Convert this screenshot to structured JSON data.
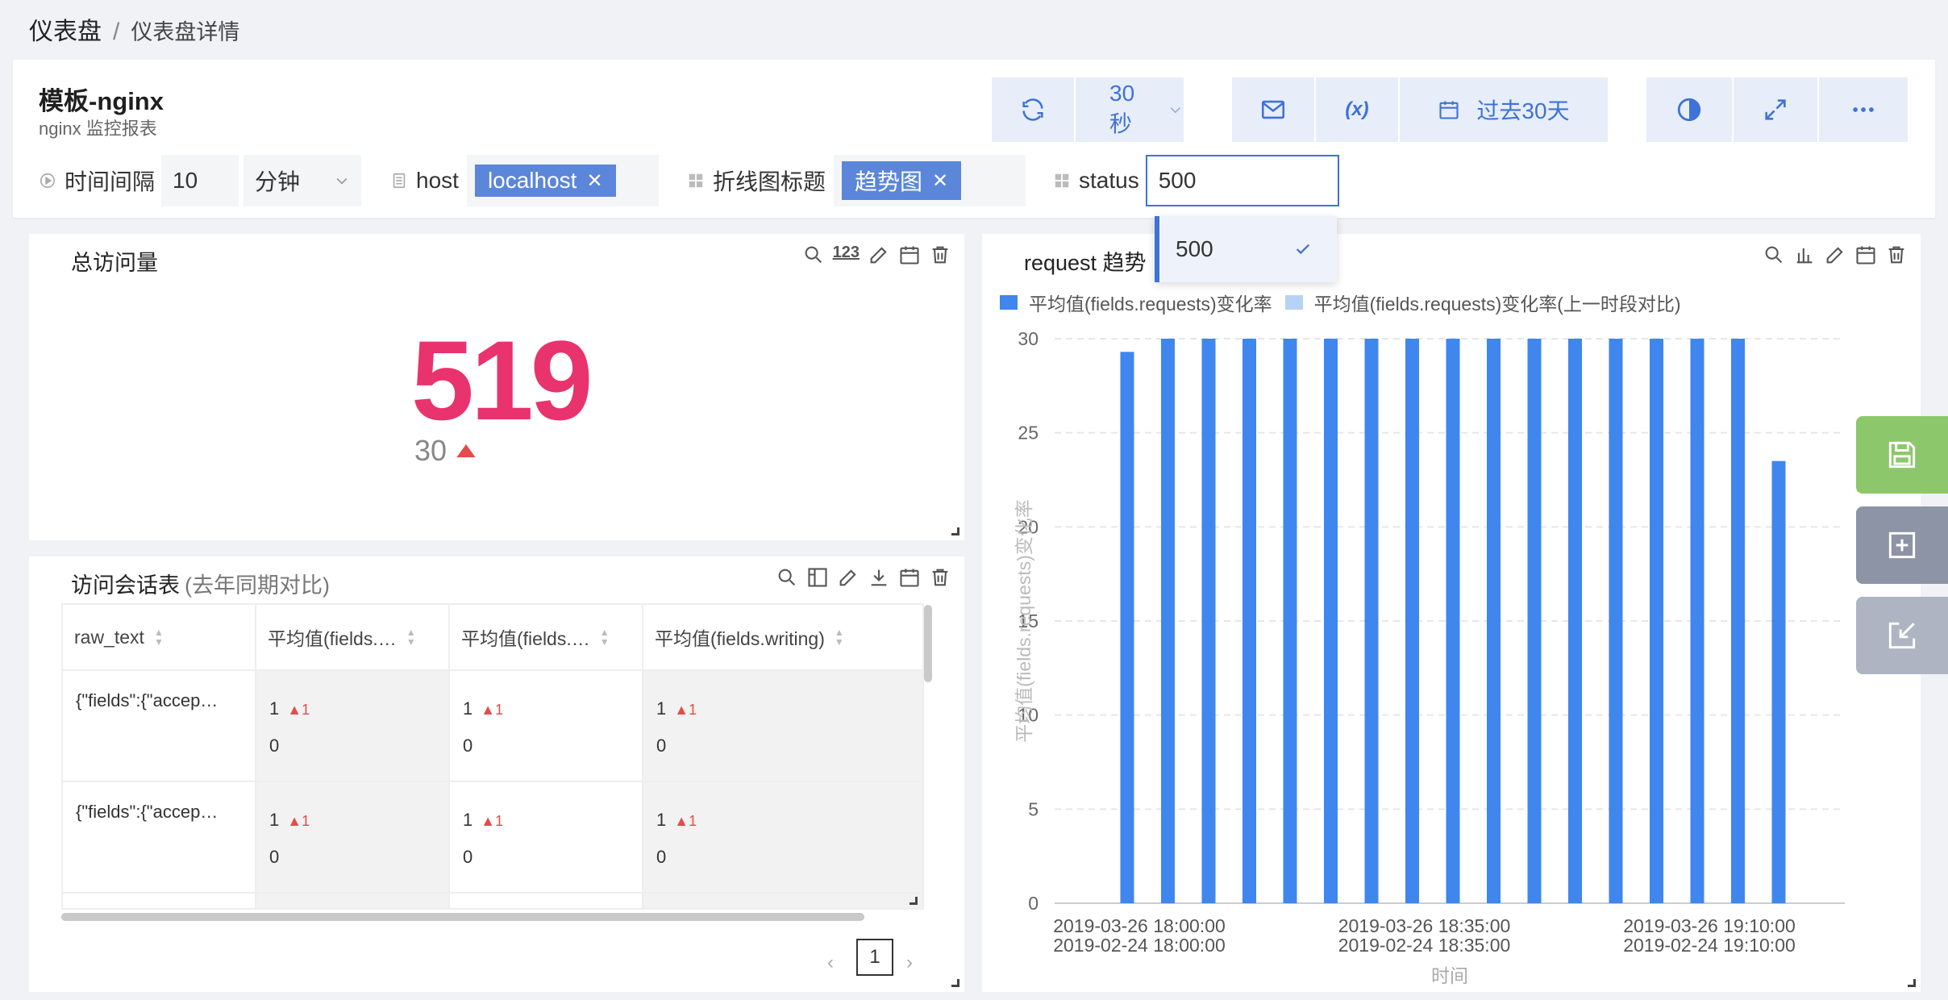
{
  "breadcrumb": {
    "root": "仪表盘",
    "separator": "/",
    "current": "仪表盘详情"
  },
  "header": {
    "title": "模板-nginx",
    "subtitle": "nginx 监控报表",
    "refresh_interval": "30秒",
    "time_range": "过去30天",
    "variable_icon_label": "(x)"
  },
  "filters": {
    "interval_label": "时间间隔",
    "interval_value": "10",
    "interval_unit": "分钟",
    "host_label": "host",
    "host_tag": "localhost",
    "line_title_label": "折线图标题",
    "line_title_tag": "趋势图",
    "status_label": "status",
    "status_value": "500"
  },
  "dropdown": {
    "option": "500"
  },
  "stat_panel": {
    "title": "总访问量",
    "value": "519",
    "delta": "30"
  },
  "table_panel": {
    "title": "访问会话表",
    "subtitle": "(去年同期对比)",
    "columns": [
      "raw_text",
      "平均值(fields.…",
      "平均值(fields.…",
      "平均值(fields.writing)"
    ],
    "rows": [
      {
        "raw": "{\"fields\":{\"accep…",
        "cells": [
          {
            "v": "1",
            "up": "1",
            "prev": "0"
          },
          {
            "v": "1",
            "up": "1",
            "prev": "0"
          },
          {
            "v": "1",
            "up": "1",
            "prev": "0"
          }
        ]
      },
      {
        "raw": "{\"fields\":{\"accep…",
        "cells": [
          {
            "v": "1",
            "up": "1",
            "prev": "0"
          },
          {
            "v": "1",
            "up": "1",
            "prev": "0"
          },
          {
            "v": "1",
            "up": "1",
            "prev": "0"
          }
        ]
      }
    ],
    "page": "1"
  },
  "chart_panel": {
    "title": "request 趋势"
  },
  "chart_data": {
    "type": "bar",
    "legend": [
      "平均值(fields.requests)变化率",
      "平均值(fields.requests)变化率(上一时段对比)"
    ],
    "ylabel": "平均值(fields.requests)变化率",
    "xlabel": "时间",
    "ylim": [
      0,
      30
    ],
    "yticks": [
      0,
      5,
      10,
      15,
      20,
      25,
      30
    ],
    "series": [
      {
        "name": "平均值(fields.requests)变化率",
        "color": "#3f86ef",
        "values": [
          29.3,
          30,
          30,
          30,
          30,
          30,
          30,
          30,
          30,
          30,
          30,
          30,
          30,
          30,
          30,
          30,
          23.5
        ]
      }
    ],
    "xtick_labels": [
      {
        "index": 0,
        "line1": "2019-03-26 18:00:00",
        "line2": "2019-02-24 18:00:00"
      },
      {
        "index": 7,
        "line1": "2019-03-26 18:35:00",
        "line2": "2019-02-24 18:35:00"
      },
      {
        "index": 14,
        "line1": "2019-03-26 19:10:00",
        "line2": "2019-02-24 19:10:00"
      }
    ],
    "colors": {
      "primary": "#3f86ef",
      "secondary": "#b7d2f7"
    }
  },
  "colors": {
    "accent": "#3f72d6",
    "stat_value": "#e8336e",
    "delta": "#888",
    "up_arrow": "#e54b4b"
  }
}
